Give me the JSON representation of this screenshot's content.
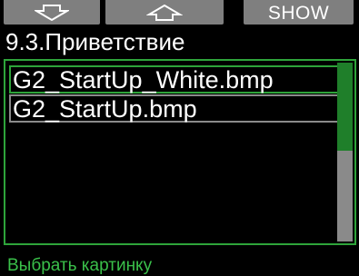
{
  "softkeys": {
    "left_icon": "down-arrow-outline-icon",
    "middle_icon": "up-arrow-outline-icon",
    "right_label": "SHOW"
  },
  "title": "9.3.Приветствие",
  "list": {
    "items": [
      {
        "label": "G2_StartUp_White.bmp",
        "state": "active"
      },
      {
        "label": "G2_StartUp.bmp",
        "state": "selected"
      }
    ],
    "scroll_position": 0.0,
    "visible_fraction": 0.49
  },
  "hint": "Выбрать картинку",
  "colors": {
    "background": "#000000",
    "softkey": "#7f7f7f",
    "accent_green": "#2ea43a",
    "hint_green": "#3ac04a",
    "scroll_thumb": "#1f7f2a",
    "selection_gray": "#8a8a8a",
    "text": "#ffffff"
  }
}
